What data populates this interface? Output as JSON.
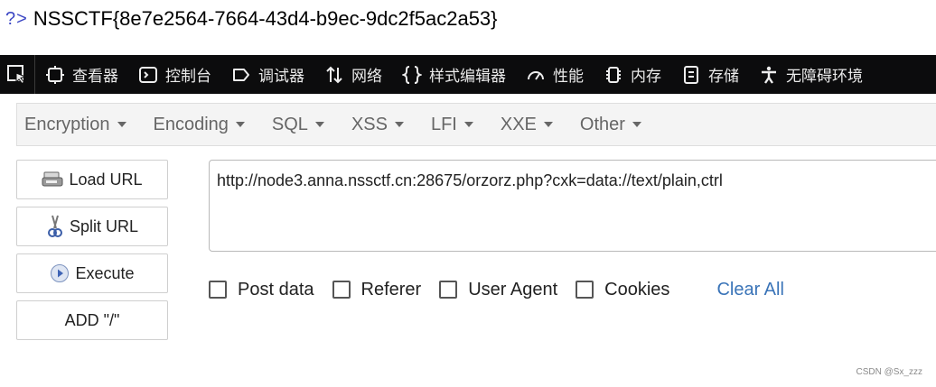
{
  "page_output": {
    "prompt": "?>",
    "flag": "NSSCTF{8e7e2564-7664-43d4-b9ec-9dc2f5ac2a53}"
  },
  "devtools": {
    "tabs": [
      {
        "label": "查看器",
        "icon": "inspector-icon"
      },
      {
        "label": "控制台",
        "icon": "console-icon"
      },
      {
        "label": "调试器",
        "icon": "debugger-icon"
      },
      {
        "label": "网络",
        "icon": "network-icon"
      },
      {
        "label": "样式编辑器",
        "icon": "style-editor-icon"
      },
      {
        "label": "性能",
        "icon": "performance-icon"
      },
      {
        "label": "内存",
        "icon": "memory-icon"
      },
      {
        "label": "存储",
        "icon": "storage-icon"
      },
      {
        "label": "无障碍环境",
        "icon": "accessibility-icon"
      }
    ]
  },
  "hackbar": {
    "menu": [
      "Encryption",
      "Encoding",
      "SQL",
      "XSS",
      "LFI",
      "XXE",
      "Other"
    ],
    "buttons": {
      "load_url": "Load URL",
      "split_url": "Split URL",
      "execute": "Execute",
      "add_slash": "ADD \"/\""
    },
    "url_value": "http://node3.anna.nssctf.cn:28675/orzorz.php?cxk=data://text/plain,ctrl",
    "options": {
      "post_data": "Post data",
      "referer": "Referer",
      "user_agent": "User Agent",
      "cookies": "Cookies",
      "clear_all": "Clear All"
    }
  },
  "watermark": "CSDN @Sx_zzz",
  "colors": {
    "devtools_bg": "#0c0c0d",
    "prompt": "#3b46c4",
    "link": "#3a74b8",
    "menu_bg": "#f4f4f4"
  }
}
